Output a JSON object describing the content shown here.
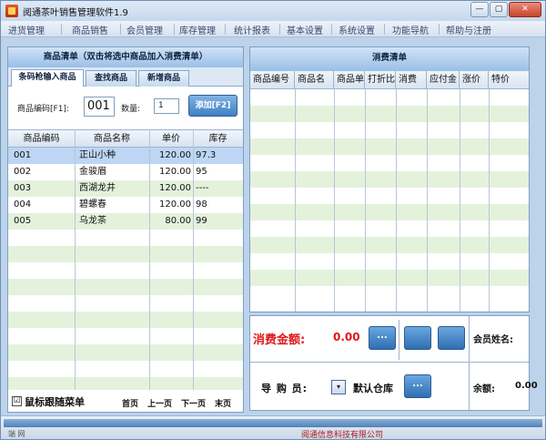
{
  "window": {
    "title": "阅通茶叶销售管理软件1.9"
  },
  "menu": [
    "进货管理",
    "商品销售",
    "会员管理",
    "库存管理",
    "统计报表",
    "基本设置",
    "系统设置",
    "功能导航",
    "帮助与注册"
  ],
  "left": {
    "header": "商品清单（双击将选中商品加入消费清单）",
    "tabs": [
      "条码枪输入商品",
      "查找商品",
      "新增商品"
    ],
    "code_label": "商品编码[F1]:",
    "code_value": "001",
    "qty_label": "数量:",
    "qty_value": "1",
    "add_button": "添加[F2]",
    "columns": [
      "商品编码",
      "商品名称",
      "单价",
      "库存"
    ],
    "rows": [
      {
        "code": "001",
        "name": "正山小种",
        "price": "120.00",
        "stock": "97.3"
      },
      {
        "code": "002",
        "name": "金骏眉",
        "price": "120.00",
        "stock": "95"
      },
      {
        "code": "003",
        "name": "西湖龙井",
        "price": "120.00",
        "stock": "----"
      },
      {
        "code": "004",
        "name": "碧螺春",
        "price": "120.00",
        "stock": "98"
      },
      {
        "code": "005",
        "name": "乌龙茶",
        "price": "80.00",
        "stock": "99"
      }
    ],
    "follow_menu_label": "鼠标跟随菜单",
    "follow_menu_checked": "☑",
    "pager": [
      "首页",
      "上一页",
      "下一页",
      "末页"
    ]
  },
  "right": {
    "header": "消费清单",
    "columns": [
      "商品编号",
      "商品名",
      "商品单",
      "打折比",
      "消费",
      "应付金",
      "涨价",
      "特价"
    ],
    "amount_label": "消费金额:",
    "amount_value": "0.00",
    "ellipsis": "...",
    "member_label": "会员姓名:",
    "guide_label": "导 购 员:",
    "dropdown_arrow": "▾",
    "warehouse": "默认仓库",
    "balance_label": "余额:",
    "balance_value": "0.00"
  },
  "status": {
    "left": "端   网",
    "right": "阅通信息科技有限公司"
  },
  "colors": {
    "accent": "#3f7fc4",
    "amount": "#e01818",
    "alt_row": "#e4f2dc"
  }
}
